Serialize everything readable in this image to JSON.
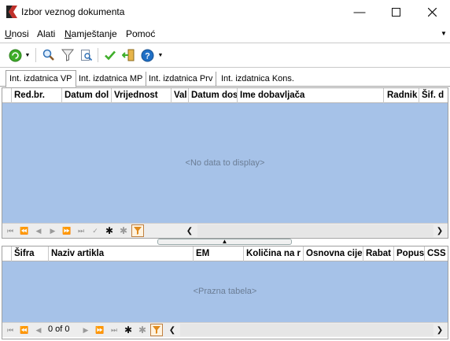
{
  "window": {
    "title": "Izbor veznog dokumenta"
  },
  "menu": [
    {
      "label_ul": "U",
      "label_rest": "nosi"
    },
    {
      "label_ul": "",
      "label_rest": "Alati"
    },
    {
      "label_ul": "N",
      "label_rest": "amještanje"
    },
    {
      "label_ul": "",
      "label_rest": "Pomoć"
    }
  ],
  "tabs": [
    "Int. izdatnica VP",
    "Int. izdatnica MP",
    "Int. izdatnica Prv",
    "Int. izdatnica Kons."
  ],
  "grid_top": {
    "columns": [
      "Red.br.",
      "Datum dol",
      "Vrijednost",
      "Val",
      "Datum dos",
      "Ime dobavljača",
      "Radnik",
      "Šif. d"
    ],
    "empty_text": "<No data to display>"
  },
  "grid_bottom": {
    "columns": [
      "Šifra",
      "Naziv artikla",
      "EM",
      "Količina na r",
      "Osnovna cije",
      "Rabat",
      "Popus",
      "CSS"
    ],
    "empty_text": "<Prazna tabela>",
    "record_counter": "0 of 0"
  },
  "colors": {
    "grid_bg": "#a6c2e8",
    "accent_green": "#3fae2a",
    "accent_blue": "#1f6fc5",
    "filter_orange": "#e08a1c"
  }
}
